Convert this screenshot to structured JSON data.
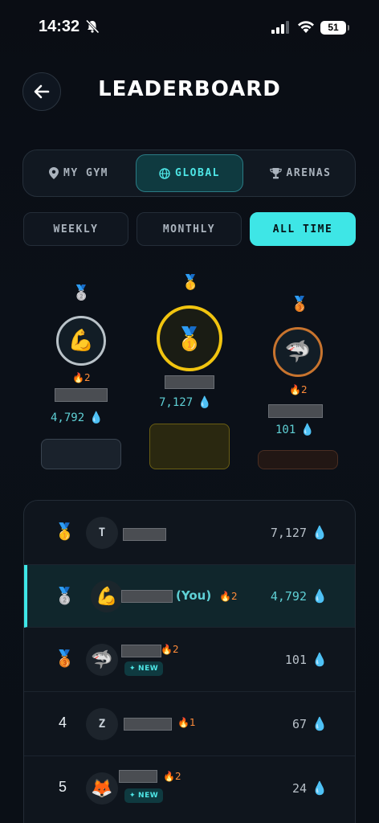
{
  "status": {
    "time": "14:32",
    "battery": "51"
  },
  "header": {
    "title": "LEADERBOARD"
  },
  "scope_tabs": [
    {
      "label": "MY GYM",
      "icon": "location-pin-icon",
      "active": false
    },
    {
      "label": "GLOBAL",
      "icon": "globe-icon",
      "active": true
    },
    {
      "label": "ARENAS",
      "icon": "trophy-icon",
      "active": false
    }
  ],
  "periods": [
    {
      "label": "WEEKLY",
      "active": false
    },
    {
      "label": "MONTHLY",
      "active": false
    },
    {
      "label": "ALL TIME",
      "active": true
    }
  ],
  "podium": [
    {
      "place": 2,
      "medal": "🥈",
      "avatar": "💪",
      "streak": "2",
      "score": "4,792",
      "ring": "#b9c2c8"
    },
    {
      "place": 1,
      "medal": "🥇",
      "avatar": "🥇",
      "streak": "",
      "score": "7,127",
      "ring": "#f1c40f"
    },
    {
      "place": 3,
      "medal": "🥉",
      "avatar": "🦈",
      "streak": "2",
      "score": "101",
      "ring": "#c8742e"
    }
  ],
  "rows": [
    {
      "rank": "1",
      "medal": "🥇",
      "avatar": "T",
      "you_label": "",
      "streak": "",
      "is_new": false,
      "score": "7,127"
    },
    {
      "rank": "2",
      "medal": "🥈",
      "avatar": "💪",
      "you_label": "(You)",
      "streak": "2",
      "is_new": false,
      "score": "4,792"
    },
    {
      "rank": "3",
      "medal": "🥉",
      "avatar": "🦈",
      "you_label": "",
      "streak": "2",
      "is_new": true,
      "score": "101"
    },
    {
      "rank": "4",
      "medal": "",
      "avatar": "Z",
      "you_label": "",
      "streak": "1",
      "is_new": false,
      "score": "67"
    },
    {
      "rank": "5",
      "medal": "",
      "avatar": "🦊",
      "you_label": "",
      "streak": "2",
      "is_new": true,
      "score": "24"
    }
  ],
  "new_label": "NEW",
  "icons": {
    "fire": "fire-icon",
    "drop": "water-drop-icon"
  },
  "colors": {
    "accent": "#3ee6e6",
    "gold": "#f1c40f",
    "silver": "#b9c2c8",
    "bronze": "#c8742e",
    "fire": "#ff8c3a",
    "drop": "#3ab6ff"
  }
}
